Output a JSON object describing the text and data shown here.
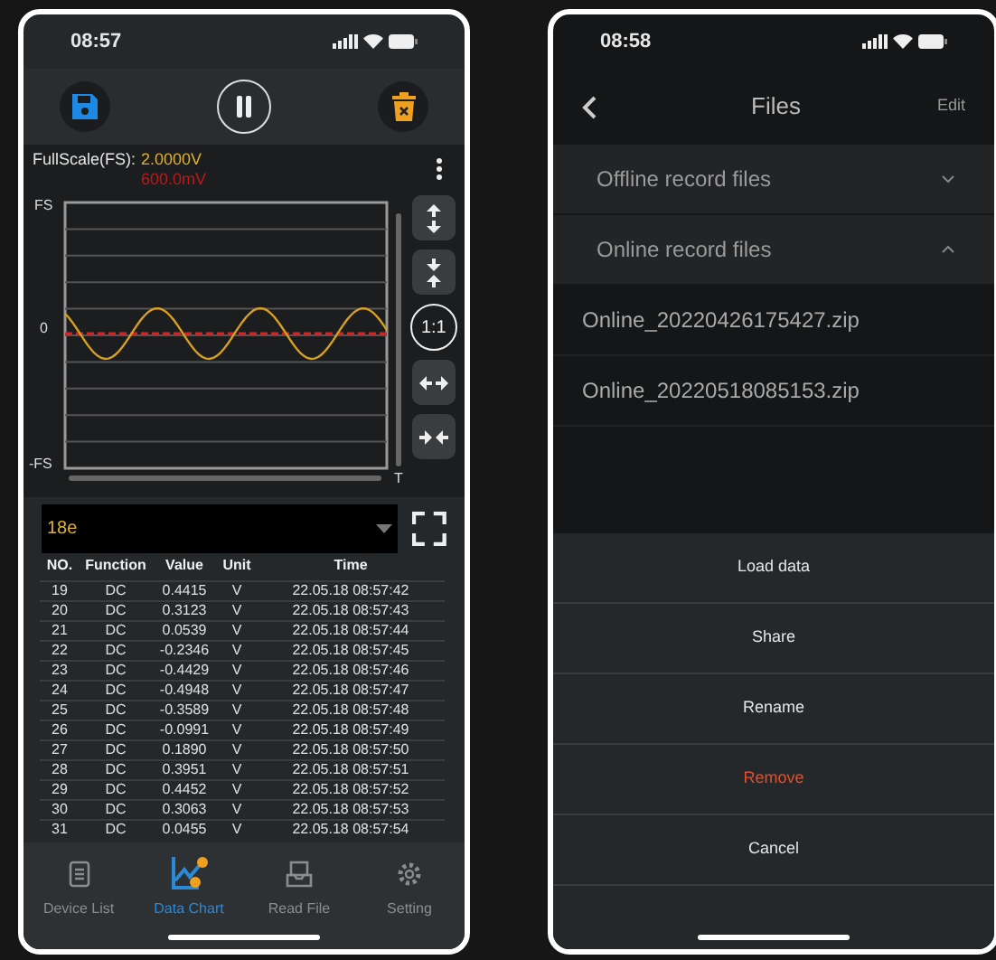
{
  "chart_screen": {
    "status_time": "08:57",
    "fullscale": {
      "label": "FullScale(FS):",
      "value": "2.0000V",
      "sub_value": "600.0mV"
    },
    "axis": {
      "top": "FS",
      "middle": "0",
      "bottom": "-FS",
      "end": "T"
    },
    "ratio_button": "1:1",
    "dropdown": {
      "value": "18e"
    },
    "table": {
      "columns": [
        "NO.",
        "Function",
        "Value",
        "Unit",
        "Time"
      ],
      "rows": [
        [
          "19",
          "DC",
          "0.4415",
          "V",
          "22.05.18 08:57:42"
        ],
        [
          "20",
          "DC",
          "0.3123",
          "V",
          "22.05.18 08:57:43"
        ],
        [
          "21",
          "DC",
          "0.0539",
          "V",
          "22.05.18 08:57:44"
        ],
        [
          "22",
          "DC",
          "-0.2346",
          "V",
          "22.05.18 08:57:45"
        ],
        [
          "23",
          "DC",
          "-0.4429",
          "V",
          "22.05.18 08:57:46"
        ],
        [
          "24",
          "DC",
          "-0.4948",
          "V",
          "22.05.18 08:57:47"
        ],
        [
          "25",
          "DC",
          "-0.3589",
          "V",
          "22.05.18 08:57:48"
        ],
        [
          "26",
          "DC",
          "-0.0991",
          "V",
          "22.05.18 08:57:49"
        ],
        [
          "27",
          "DC",
          "0.1890",
          "V",
          "22.05.18 08:57:50"
        ],
        [
          "28",
          "DC",
          "0.3951",
          "V",
          "22.05.18 08:57:51"
        ],
        [
          "29",
          "DC",
          "0.4452",
          "V",
          "22.05.18 08:57:52"
        ],
        [
          "30",
          "DC",
          "0.3063",
          "V",
          "22.05.18 08:57:53"
        ],
        [
          "31",
          "DC",
          "0.0455",
          "V",
          "22.05.18 08:57:54"
        ]
      ]
    },
    "tabs": [
      {
        "label": "Device List",
        "kind": "list",
        "selected": false
      },
      {
        "label": "Data Chart",
        "kind": "chart",
        "selected": true
      },
      {
        "label": "Read File",
        "kind": "file",
        "selected": false
      },
      {
        "label": "Setting",
        "kind": "gear",
        "selected": false
      }
    ]
  },
  "files_screen": {
    "status_time": "08:58",
    "title": "Files",
    "edit": "Edit",
    "sections": [
      {
        "label": "Offline record files",
        "expanded": false
      },
      {
        "label": "Online record files",
        "expanded": true,
        "files": [
          "Online_20220426175427.zip",
          "Online_20220518085153.zip"
        ]
      }
    ],
    "actions": [
      {
        "label": "Load data",
        "destructive": false
      },
      {
        "label": "Share",
        "destructive": false
      },
      {
        "label": "Rename",
        "destructive": false
      },
      {
        "label": "Remove",
        "destructive": true
      },
      {
        "label": "Cancel",
        "destructive": false
      }
    ]
  }
}
